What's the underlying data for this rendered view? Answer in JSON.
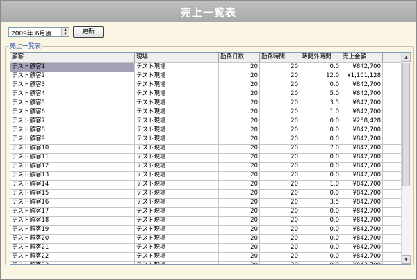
{
  "title": "売上一覧表",
  "period": {
    "value": "2009年 6月度",
    "up": "▲",
    "down": "▼"
  },
  "refresh_label": "更新",
  "group_label": "売上一覧表",
  "columns": [
    "顧客",
    "現場",
    "勤務日数",
    "勤務時間",
    "時間外時間",
    "売上金額"
  ],
  "rows": [
    [
      "テスト顧客1",
      "テスト現場",
      "20",
      "20",
      "0.0",
      "¥842,700"
    ],
    [
      "テスト顧客2",
      "テスト現場",
      "20",
      "20",
      "12.0",
      "¥1,101,128"
    ],
    [
      "テスト顧客3",
      "テスト現場",
      "20",
      "20",
      "0.0",
      "¥842,700"
    ],
    [
      "テスト顧客4",
      "テスト現場",
      "20",
      "20",
      "5.0",
      "¥842,700"
    ],
    [
      "テスト顧客5",
      "テスト現場",
      "20",
      "20",
      "3.5",
      "¥842,700"
    ],
    [
      "テスト顧客6",
      "テスト現場",
      "20",
      "20",
      "1.0",
      "¥842,700"
    ],
    [
      "テスト顧客7",
      "テスト現場",
      "20",
      "20",
      "0.0",
      "¥258,428"
    ],
    [
      "テスト顧客8",
      "テスト現場",
      "20",
      "20",
      "0.0",
      "¥842,700"
    ],
    [
      "テスト顧客9",
      "テスト現場",
      "20",
      "20",
      "0.0",
      "¥842,700"
    ],
    [
      "テスト顧客10",
      "テスト現場",
      "20",
      "20",
      "7.0",
      "¥842,700"
    ],
    [
      "テスト顧客11",
      "テスト現場",
      "20",
      "20",
      "0.0",
      "¥842,700"
    ],
    [
      "テスト顧客12",
      "テスト現場",
      "20",
      "20",
      "0.0",
      "¥842,700"
    ],
    [
      "テスト顧客13",
      "テスト現場",
      "20",
      "20",
      "0.0",
      "¥842,700"
    ],
    [
      "テスト顧客14",
      "テスト現場",
      "20",
      "20",
      "1.0",
      "¥842,700"
    ],
    [
      "テスト顧客15",
      "テスト現場",
      "20",
      "20",
      "0.0",
      "¥842,700"
    ],
    [
      "テスト顧客16",
      "テスト現場",
      "20",
      "20",
      "3.5",
      "¥842,700"
    ],
    [
      "テスト顧客17",
      "テスト現場",
      "20",
      "20",
      "0.0",
      "¥842,700"
    ],
    [
      "テスト顧客18",
      "テスト現場",
      "20",
      "20",
      "0.0",
      "¥842,700"
    ],
    [
      "テスト顧客19",
      "テスト現場",
      "20",
      "20",
      "0.0",
      "¥842,700"
    ],
    [
      "テスト顧客20",
      "テスト現場",
      "20",
      "20",
      "0.0",
      "¥842,700"
    ],
    [
      "テスト顧客21",
      "テスト現場",
      "20",
      "20",
      "0.0",
      "¥842,700"
    ],
    [
      "テスト顧客22",
      "テスト現場",
      "20",
      "20",
      "0.0",
      "¥842,700"
    ],
    [
      "テスト顧客23",
      "テスト現場",
      "20",
      "20",
      "0.0",
      "¥842,700"
    ]
  ],
  "selected_row": 0,
  "scrollbar": {
    "up": "▲",
    "down": "▼"
  }
}
